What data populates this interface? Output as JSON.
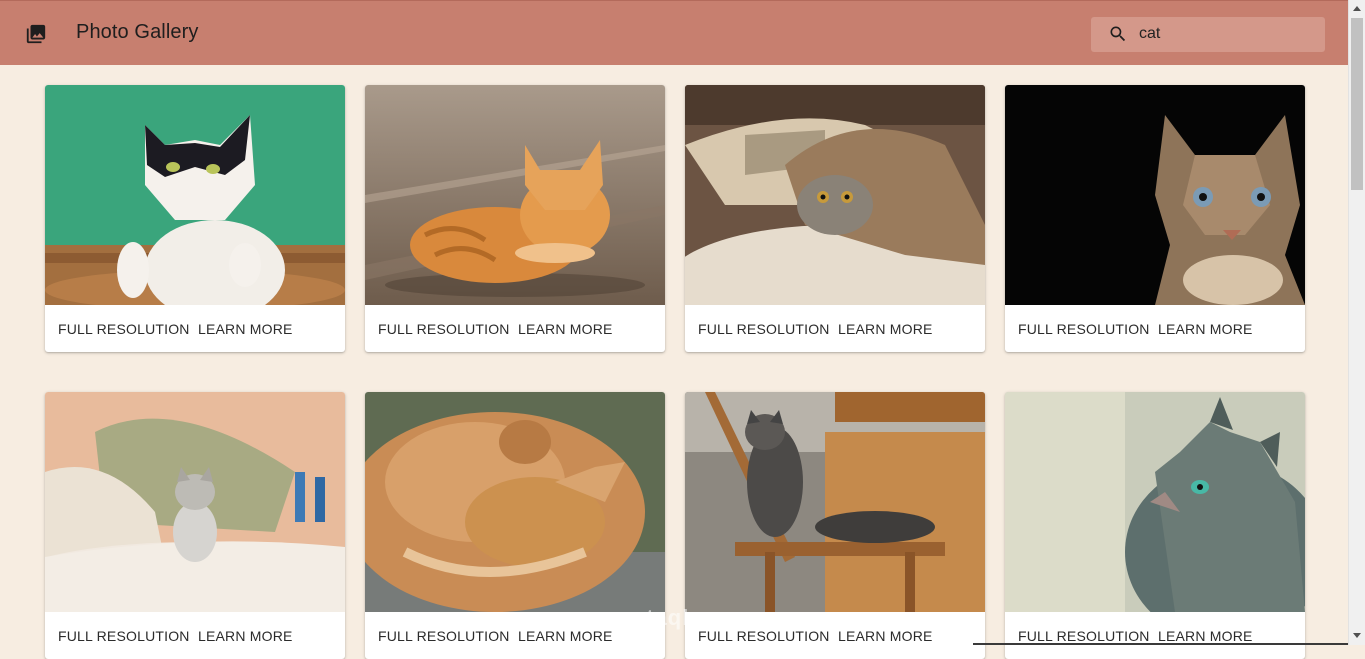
{
  "header": {
    "title": "Photo Gallery",
    "app_icon": "photo-library-icon",
    "search_icon": "search-icon",
    "search_value": "cat",
    "colors": {
      "appbar": "#c77f6f",
      "search_bg": "#d4988a",
      "page_bg": "#f7ede1"
    }
  },
  "gallery": {
    "cards": [
      {
        "photo": "black-and-white cat with paws on wooden ledge, green wall",
        "full": "FULL RESOLUTION",
        "learn": "LEARN MORE"
      },
      {
        "photo": "orange tabby cat lying on wooden floor",
        "full": "FULL RESOLUTION",
        "learn": "LEARN MORE"
      },
      {
        "photo": "tabby kitten peeking from under blanket on pillow",
        "full": "FULL RESOLUTION",
        "learn": "LEARN MORE"
      },
      {
        "photo": "siamese tabby cat on black background",
        "full": "FULL RESOLUTION",
        "learn": "LEARN MORE"
      },
      {
        "photo": "small kitten on bed with pillows",
        "full": "FULL RESOLUTION",
        "learn": "LEARN MORE"
      },
      {
        "photo": "fluffy orange cat rolling on rug",
        "full": "FULL RESOLUTION",
        "learn": "LEARN MORE"
      },
      {
        "photo": "tabby cat sitting on wooden chair",
        "full": "FULL RESOLUTION",
        "learn": "LEARN MORE"
      },
      {
        "photo": "gray tabby cat with green eyes looking up",
        "full": "FULL RESOLUTION",
        "learn": "LEARN MORE"
      }
    ]
  },
  "watermark": "mostaql.com"
}
